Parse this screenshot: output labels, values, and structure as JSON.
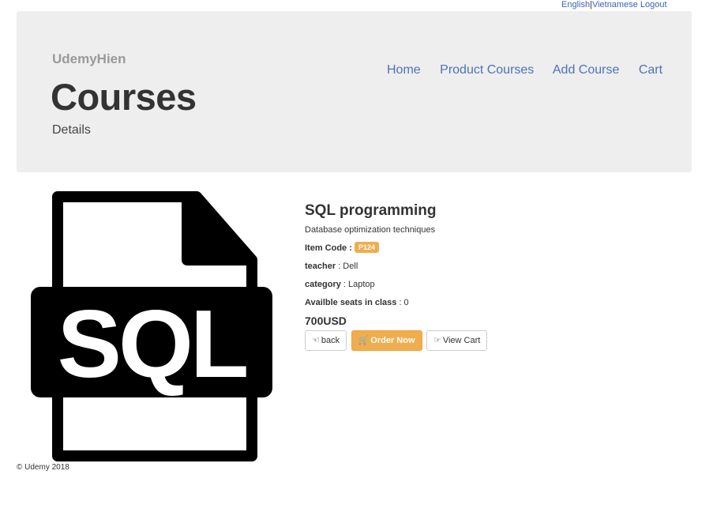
{
  "topbar": {
    "english": "English",
    "separator": "|",
    "vietnamese": "Vietnamese",
    "logout": "Logout"
  },
  "header": {
    "brand": "UdemyHien",
    "title": "Courses",
    "subtitle": "Details"
  },
  "nav": {
    "items": [
      {
        "label": "Home"
      },
      {
        "label": "Product Courses"
      },
      {
        "label": "Add Course"
      },
      {
        "label": "Cart"
      }
    ]
  },
  "product": {
    "image_label": "SQL",
    "name": "SQL programming",
    "description": "Database optimization techniques",
    "item_code_label": "Item Code :",
    "item_code": "P124",
    "teacher_label": "teacher",
    "teacher": " : Dell",
    "category_label": "category",
    "category": " : Laptop",
    "seats_label": "Availble seats in class",
    "seats": " : 0",
    "price": "700USD"
  },
  "buttons": {
    "back": "back",
    "order": "Order Now",
    "view_cart": "View Cart"
  },
  "icons": {
    "back": "hand-left-icon",
    "order": "shopping-cart-icon",
    "view_cart": "hand-right-icon"
  },
  "colors": {
    "accent": "#f0ad4e",
    "link": "#4d72b9",
    "jumbotron_bg": "#eeeeee"
  },
  "footer": {
    "copyright": "© Udemy 2018"
  }
}
